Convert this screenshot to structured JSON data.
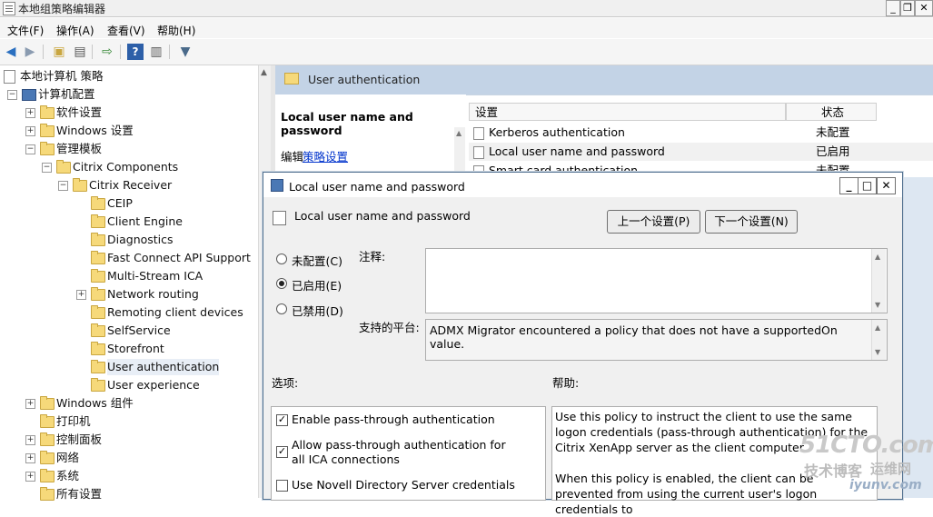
{
  "window": {
    "title": "本地组策略编辑器"
  },
  "menu": [
    "文件(F)",
    "操作(A)",
    "查看(V)",
    "帮助(H)"
  ],
  "tree": [
    {
      "label": "本地计算机 策略",
      "level": 0,
      "icon": "document-icon",
      "expander": ""
    },
    {
      "label": "计算机配置",
      "level": 1,
      "icon": "computer-icon",
      "expander": "−"
    },
    {
      "label": "软件设置",
      "level": 2,
      "icon": "folder-icon",
      "expander": "+"
    },
    {
      "label": "Windows 设置",
      "level": 2,
      "icon": "folder-icon",
      "expander": "+"
    },
    {
      "label": "管理模板",
      "level": 2,
      "icon": "folder-icon",
      "expander": "−"
    },
    {
      "label": "Citrix Components",
      "level": 3,
      "icon": "folder-icon",
      "expander": "−"
    },
    {
      "label": "Citrix Receiver",
      "level": 4,
      "icon": "folder-icon",
      "expander": "−"
    },
    {
      "label": "CEIP",
      "level": 5,
      "icon": "folder-icon",
      "expander": ""
    },
    {
      "label": "Client Engine",
      "level": 5,
      "icon": "folder-icon",
      "expander": ""
    },
    {
      "label": "Diagnostics",
      "level": 5,
      "icon": "folder-icon",
      "expander": ""
    },
    {
      "label": "Fast Connect API Support",
      "level": 5,
      "icon": "folder-icon",
      "expander": ""
    },
    {
      "label": "Multi-Stream ICA",
      "level": 5,
      "icon": "folder-icon",
      "expander": ""
    },
    {
      "label": "Network routing",
      "level": 5,
      "icon": "folder-icon",
      "expander": "+"
    },
    {
      "label": "Remoting client devices",
      "level": 5,
      "icon": "folder-icon",
      "expander": ""
    },
    {
      "label": "SelfService",
      "level": 5,
      "icon": "folder-icon",
      "expander": ""
    },
    {
      "label": "Storefront",
      "level": 5,
      "icon": "folder-icon",
      "expander": ""
    },
    {
      "label": "User authentication",
      "level": 5,
      "icon": "folder-icon",
      "expander": "",
      "selected": true
    },
    {
      "label": "User experience",
      "level": 5,
      "icon": "folder-icon",
      "expander": ""
    },
    {
      "label": "Windows 组件",
      "level": 2,
      "icon": "folder-icon",
      "expander": "+"
    },
    {
      "label": "打印机",
      "level": 2,
      "icon": "folder-icon",
      "expander": ""
    },
    {
      "label": "控制面板",
      "level": 2,
      "icon": "folder-icon",
      "expander": "+"
    },
    {
      "label": "网络",
      "level": 2,
      "icon": "folder-icon",
      "expander": "+"
    },
    {
      "label": "系统",
      "level": 2,
      "icon": "folder-icon",
      "expander": "+"
    },
    {
      "label": "所有设置",
      "level": 2,
      "icon": "folder-icon",
      "expander": ""
    }
  ],
  "right": {
    "header": "User authentication",
    "extended_title": "Local user name and password",
    "edit_prefix": "编辑",
    "edit_link": "策略设置",
    "columns": [
      "设置",
      "状态"
    ],
    "rows": [
      {
        "name": "Kerberos authentication",
        "state": "未配置"
      },
      {
        "name": "Local user name and password",
        "state": "已启用"
      },
      {
        "name": "Smart card authentication",
        "state": "未配置"
      }
    ]
  },
  "dialog": {
    "title": "Local user name and password",
    "subtitle": "Local user name and password",
    "prev_button": "上一个设置(P)",
    "next_button": "下一个设置(N)",
    "radios": [
      {
        "label": "未配置(C)",
        "checked": false
      },
      {
        "label": "已启用(E)",
        "checked": true
      },
      {
        "label": "已禁用(D)",
        "checked": false
      }
    ],
    "comment_label": "注释:",
    "comment_value": "",
    "platform_label": "支持的平台:",
    "platform_value": "ADMX Migrator encountered a policy that does not have a supportedOn value.",
    "options_label": "选项:",
    "help_label": "帮助:",
    "options": [
      {
        "label": "Enable pass-through authentication",
        "checked": true
      },
      {
        "label": "Allow pass-through authentication for all ICA connections",
        "checked": true
      },
      {
        "label": "Use Novell Directory Server credentials",
        "checked": false
      }
    ],
    "help_p1": "Use this policy to instruct the client to use the same logon credentials (pass-through authentication) for the Citrix XenApp server as the client computer.",
    "help_p2": "When this policy is enabled, the client can be prevented from using the current user's logon credentials to"
  },
  "watermark": {
    "line1": "51CTO.com",
    "line2": "技术博客",
    "line3": "运维网",
    "line4": "iyunv.com"
  },
  "colors": {
    "header_bg": "#c3d3e6",
    "pane_bg": "#dde7f2",
    "link": "#0033cc",
    "dialog_border": "#4f6f8f"
  }
}
